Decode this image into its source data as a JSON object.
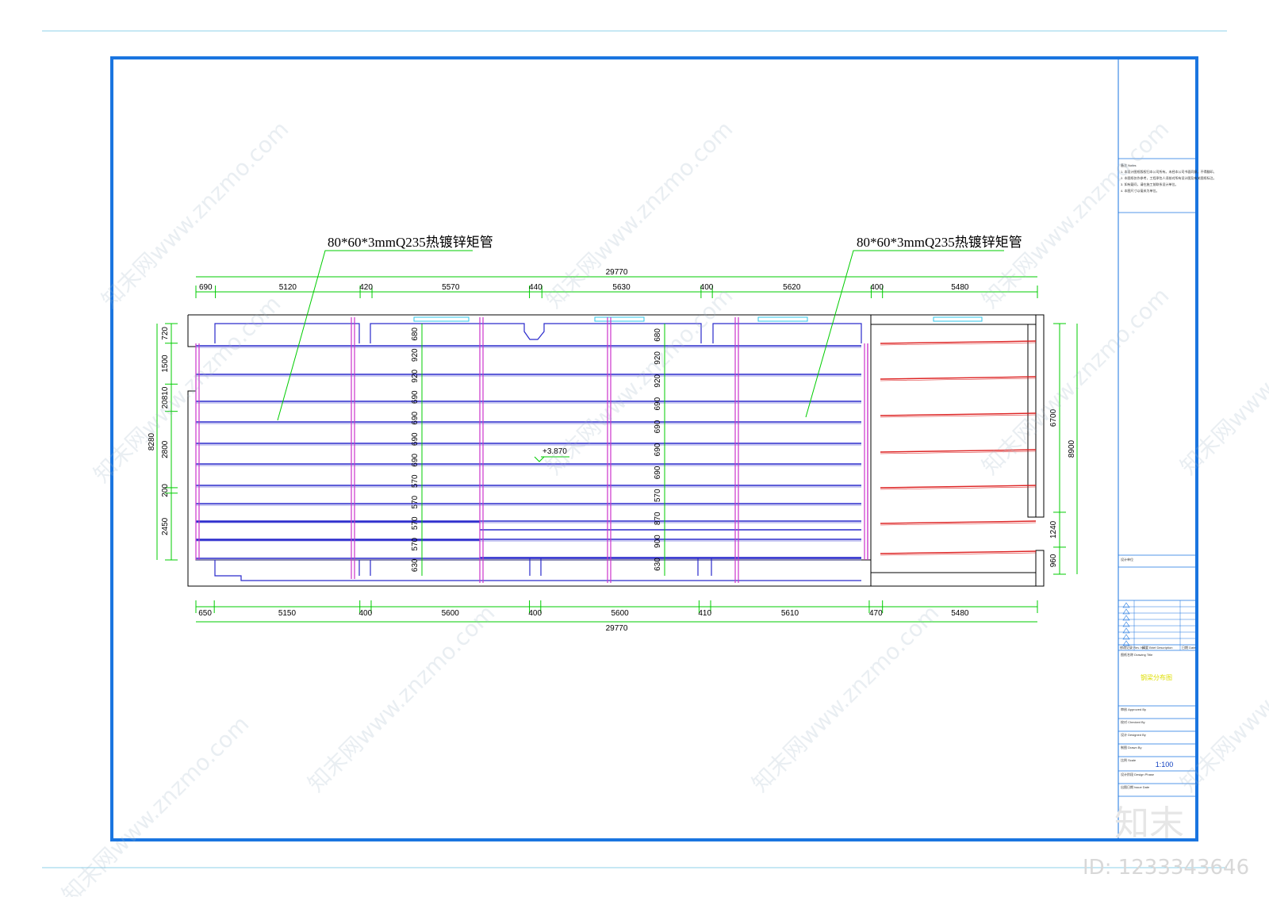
{
  "callouts": {
    "left": "80*60*3mmQ235热镀锌矩管",
    "right": "80*60*3mmQ235热镀锌矩管"
  },
  "elevation": "+3.870",
  "top_dims": {
    "total": "29770",
    "segments": [
      "690",
      "5120",
      "420",
      "5570",
      "440",
      "5630",
      "400",
      "5620",
      "400",
      "5480"
    ]
  },
  "bottom_dims": {
    "total": "29770",
    "segments": [
      "650",
      "5150",
      "400",
      "5600",
      "400",
      "5600",
      "410",
      "5610",
      "470",
      "5480"
    ]
  },
  "left_dims": {
    "total": "8280",
    "segments": [
      "720",
      "1500",
      "20810",
      "2800",
      "200",
      "2450"
    ]
  },
  "right_dims": {
    "total": "8900",
    "segments": [
      "6700",
      "1240",
      "960"
    ]
  },
  "spacing_col1": [
    "680",
    "920",
    "920",
    "690",
    "690",
    "690",
    "690",
    "570",
    "570",
    "570",
    "570",
    "630"
  ],
  "spacing_col2": [
    "680",
    "920",
    "920",
    "690",
    "690",
    "690",
    "690",
    "570",
    "870",
    "900",
    "630"
  ],
  "title_block": {
    "notes_heading": "备注 Notes",
    "notes_lines": [
      "1. 本设计图纸版权归本公司所有。未经本公司书面同意，不得翻印。",
      "2. 本图纸仅作参考，工程承包人须核对所有设计图及有关图纸标注。",
      "3. 如有疑问，请在施工前联系设计单位。",
      "4. 本图尺寸以毫米为单位。"
    ],
    "designer_label": "设计单位",
    "rev_headers": [
      "修改记录 Rev. No.",
      "摘要 Brief Description",
      "日期 Date"
    ],
    "drawing_title_label": "图纸名称 Drawing Title",
    "drawing_title": "钢梁分布图",
    "approved_label": "审核 Approved By",
    "checked_label": "校对 Checked By",
    "designed_label": "设计 Designed By",
    "drawn_label": "制图 Drawn By",
    "scale_label": "比例 Scale",
    "scale_value": "1:100",
    "phase_label": "设计阶段 Design Phase",
    "date_label": "出图日期 Issue Date"
  },
  "watermarks": {
    "text": "知末网www.znzmo.com",
    "logo": "知末",
    "id": "ID: 1233343646"
  },
  "colors": {
    "frame": "#1a75e0",
    "guide": "#8fd0e8",
    "dimension": "#00cc00",
    "beam": "#2a2acc",
    "post": "#cc33cc",
    "red_beam": "#dd2222",
    "window": "#2ec4ea"
  }
}
